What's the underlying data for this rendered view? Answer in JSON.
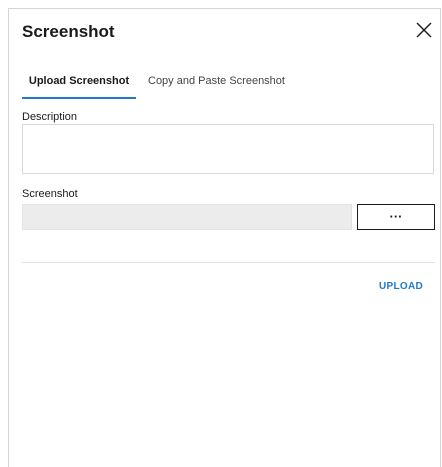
{
  "dialog": {
    "title": "Screenshot",
    "close_icon": "close-icon"
  },
  "tabs": [
    {
      "label": "Upload Screenshot",
      "active": true
    },
    {
      "label": "Copy and Paste Screenshot",
      "active": false
    }
  ],
  "form": {
    "description_label": "Description",
    "description_value": "",
    "screenshot_label": "Screenshot",
    "screenshot_value": "",
    "browse_label": "···"
  },
  "footer": {
    "upload_label": "UPLOAD"
  },
  "colors": {
    "accent": "#1f7ac9",
    "input_disabled_bg": "#ececec",
    "border": "#d9d9d9"
  }
}
